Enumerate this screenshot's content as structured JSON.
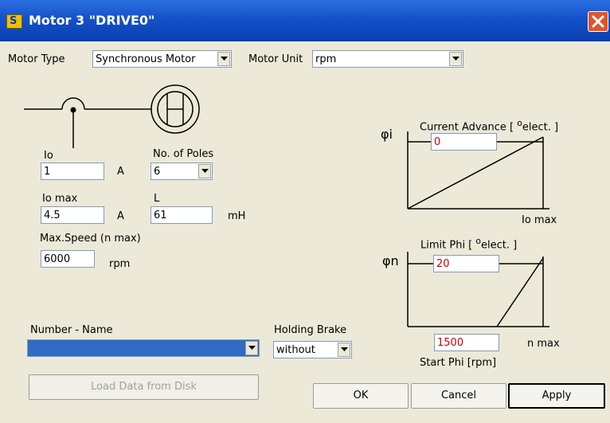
{
  "window": {
    "title": "Motor 3 \"DRIVE0\"",
    "app_icon": "app-icon",
    "close_icon": "close-icon"
  },
  "motor_type": {
    "label": "Motor Type",
    "value": "Synchronous Motor"
  },
  "motor_unit": {
    "label": "Motor Unit",
    "value": "rpm"
  },
  "io": {
    "label": "Io",
    "value": "1",
    "unit": "A"
  },
  "poles": {
    "label": "No. of Poles",
    "value": "6"
  },
  "io_max": {
    "label": "Io max",
    "value": "4.5",
    "unit": "A"
  },
  "inductance": {
    "label": "L",
    "value": "61",
    "unit": "mH"
  },
  "max_speed": {
    "label": "Max.Speed (n max)",
    "value": "6000",
    "unit": "rpm"
  },
  "current_advance": {
    "symbol": "φi",
    "label": "Current Advance [",
    "unit_sup": "o",
    "unit": "elect. ]",
    "value": "0",
    "x_label": "Io max"
  },
  "limit_phi": {
    "symbol": "φn",
    "label": "Limit Phi [",
    "unit_sup": "o",
    "unit": "elect. ]",
    "value": "20",
    "x_label": "n max"
  },
  "start_phi": {
    "label": "Start Phi  [rpm]",
    "value": "1500"
  },
  "number_name": {
    "label": "Number - Name",
    "value": ""
  },
  "holding_brake": {
    "label": "Holding Brake",
    "value": "without"
  },
  "buttons": {
    "load": "Load Data from Disk",
    "ok": "OK",
    "cancel": "Cancel",
    "apply": "Apply"
  }
}
